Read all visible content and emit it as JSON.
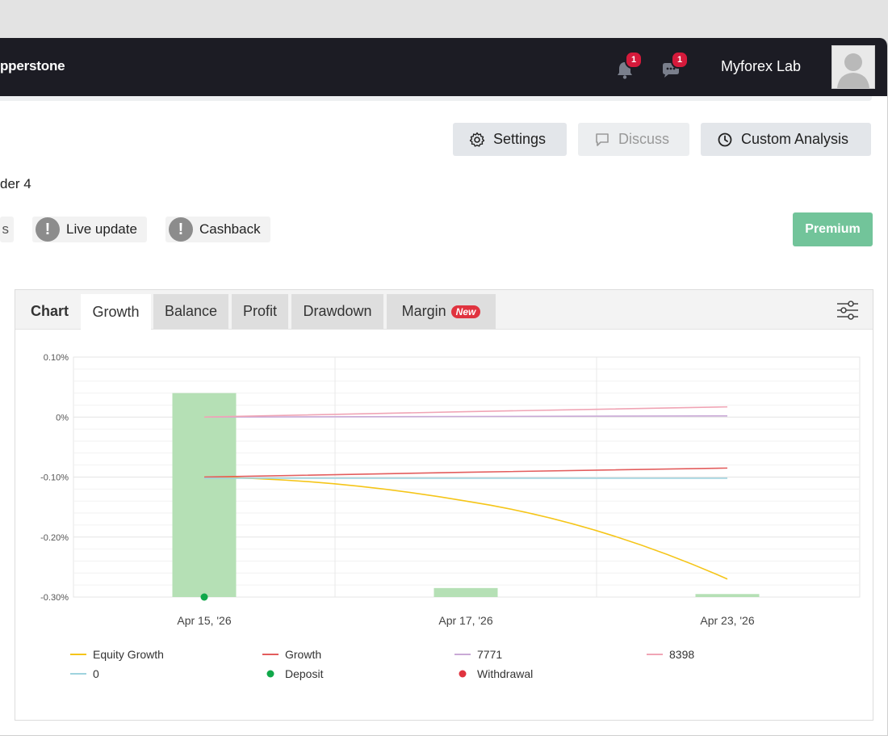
{
  "header": {
    "brand": "pperstone",
    "notifications_count": "1",
    "messages_count": "1",
    "user_name": "Myforex Lab"
  },
  "actions": {
    "settings": "Settings",
    "discuss": "Discuss",
    "custom_analysis": "Custom Analysis"
  },
  "sub_label": "der 4",
  "chips": {
    "partial": "s",
    "live_update": "Live update",
    "cashback": "Cashback"
  },
  "premium": "Premium",
  "chart_tabs": {
    "title": "Chart",
    "items": [
      "Growth",
      "Balance",
      "Profit",
      "Drawdown",
      "Margin"
    ],
    "active": "Growth",
    "new_badge": "New"
  },
  "chart_data": {
    "type": "line",
    "x": [
      "Apr 15, '26",
      "Apr 17, '26",
      "Apr 23, '26"
    ],
    "ylim": [
      -0.3,
      0.1
    ],
    "yticks": [
      "0.10%",
      "0%",
      "-0.10%",
      "-0.20%",
      "-0.30%"
    ],
    "grid": true,
    "legend_position": "bottom",
    "series": [
      {
        "name": "Equity Growth",
        "type": "line",
        "color": "#f5c518",
        "values": [
          -0.1,
          -0.14,
          -0.27
        ]
      },
      {
        "name": "Growth",
        "type": "line",
        "color": "#e35d5d",
        "values": [
          -0.1,
          -0.092,
          -0.085
        ]
      },
      {
        "name": "7771",
        "type": "line",
        "color": "#c9a9d6",
        "values": [
          0.0,
          0.001,
          0.002
        ]
      },
      {
        "name": "8398",
        "type": "line",
        "color": "#f0a5b5",
        "values": [
          0.0,
          0.009,
          0.017
        ]
      },
      {
        "name": "0",
        "type": "line",
        "color": "#9fd3de",
        "values": [
          -0.102,
          -0.102,
          -0.102
        ]
      },
      {
        "name": "Deposit",
        "type": "marker",
        "color": "#10a84a",
        "values": [
          -0.3,
          null,
          null
        ]
      },
      {
        "name": "Withdrawal",
        "type": "marker",
        "color": "#e0333f",
        "values": [
          null,
          null,
          null
        ]
      }
    ],
    "bars": {
      "color": "#b5e0b5",
      "values": [
        0.04,
        -0.285,
        -0.295
      ],
      "base": -0.3
    }
  }
}
